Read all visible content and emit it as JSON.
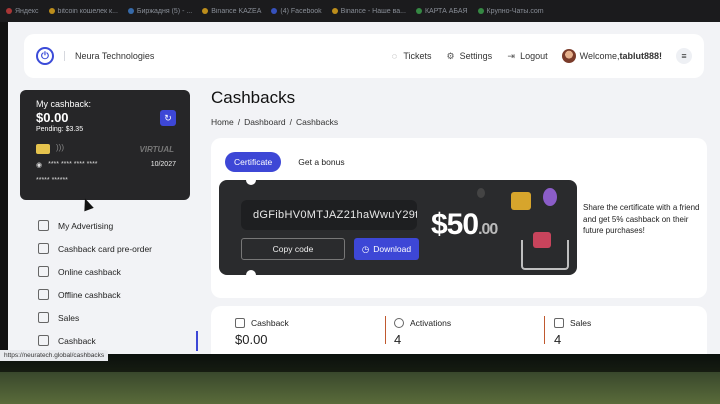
{
  "browser": {
    "bookmarks": [
      "Яндекс",
      "bitcoin кошелек к...",
      "Биржадня (5) - ...",
      "Binance KAZEA",
      "(4) Facebook",
      "Binance - Наше ва...",
      "КАРТА АБАЯ",
      "Крупно-Чаты.com"
    ]
  },
  "header": {
    "brand": "Neura Technologies",
    "tickets": "Tickets",
    "settings": "Settings",
    "logout": "Logout",
    "welcome_prefix": "Welcome, ",
    "username": "tablut888!"
  },
  "cashback_card": {
    "title": "My cashback:",
    "amount": "$0.00",
    "pending": "Pending: $3.35",
    "virtual": "VIRTUAL",
    "card_number": "**** **** **** ****",
    "expiry": "10/2027",
    "holder": "***** ******"
  },
  "sidebar": {
    "items": [
      {
        "label": "My Advertising",
        "icon": "advertising-icon"
      },
      {
        "label": "Cashback card pre-order",
        "icon": "card-icon"
      },
      {
        "label": "Online cashback",
        "icon": "online-icon"
      },
      {
        "label": "Offline cashback",
        "icon": "offline-icon"
      },
      {
        "label": "Sales",
        "icon": "sales-icon"
      },
      {
        "label": "Cashback",
        "icon": "cashback-icon"
      }
    ]
  },
  "main": {
    "title": "Cashbacks",
    "breadcrumb": [
      "Home",
      "/",
      "Dashboard",
      "/",
      "Cashbacks"
    ]
  },
  "tabs": [
    "Certificate",
    "Get a bonus"
  ],
  "certificate": {
    "code": "dGFibHV0MTJAZ21haWwuY29t",
    "copy_label": "Copy code",
    "download_label": "Download",
    "price_main": "$50",
    "price_cents": ".00",
    "description": "Share the certificate with a friend and get 5% cashback on their future purchases!"
  },
  "stats": {
    "cashback_label": "Cashback",
    "cashback_value": "$0.00",
    "activations_label": "Activations",
    "activations_value": "4",
    "sales_label": "Sales",
    "sales_value": "4"
  },
  "status_url": "https://neuratech.global/cashbacks",
  "colors": {
    "accent": "#3d47d6",
    "dark": "#2a2b2d"
  }
}
